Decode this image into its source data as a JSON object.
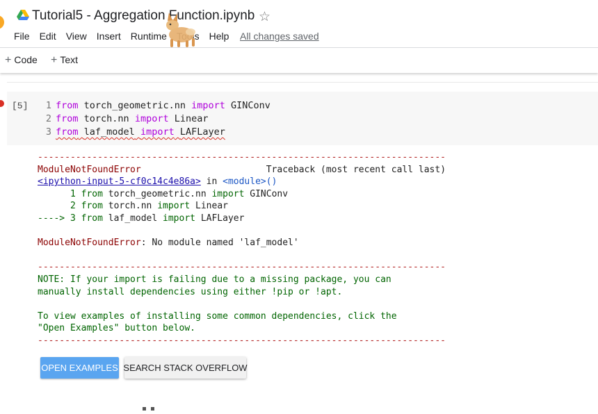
{
  "header": {
    "title": "Tutorial5 - Aggregation Function.ipynb",
    "star_icon": "star-outline-icon",
    "menu": [
      "File",
      "Edit",
      "View",
      "Insert",
      "Runtime",
      "Tools",
      "Help"
    ],
    "save_status": "All changes saved"
  },
  "toolbar": {
    "add_code": "Code",
    "add_text": "Text",
    "plus_glyph": "+"
  },
  "cell": {
    "exec_count": "[5]",
    "lines": [
      {
        "n": "1",
        "kw1": "from",
        "mod": "torch_geometric.nn",
        "kw2": "import",
        "name": "GINConv"
      },
      {
        "n": "2",
        "kw1": "from",
        "mod": "torch.nn",
        "kw2": "import",
        "name": "Linear"
      },
      {
        "n": "3",
        "kw1": "from",
        "mod": "laf_model",
        "kw2": "import",
        "name": "LAFLayer"
      }
    ]
  },
  "output": {
    "dashes": "---------------------------------------------------------------------------",
    "error_type": "ModuleNotFoundError",
    "traceback_label": "Traceback (most recent call last)",
    "input_link": "<ipython-input-5-cf0c14c4e86a>",
    "in_word": " in ",
    "module_word": "<module>()",
    "tb_lines": [
      {
        "prefix": "      1 ",
        "text_kw1": "from",
        "text_mod": " torch_geometric.nn ",
        "text_kw2": "import",
        "text_name": " GINConv"
      },
      {
        "prefix": "      2 ",
        "text_kw1": "from",
        "text_mod": " torch.nn ",
        "text_kw2": "import",
        "text_name": " Linear"
      },
      {
        "prefix": "----> 3 ",
        "text_kw1": "from",
        "text_mod": " laf_model ",
        "text_kw2": "import",
        "text_name": " LAFLayer"
      }
    ],
    "error_message": ": No module named 'laf_model'",
    "note_line1": "NOTE: If your import is failing due to a missing package, you can",
    "note_line2": "manually install dependencies using either !pip or !apt.",
    "note_line3": "To view examples of installing some common dependencies, click the",
    "note_line4": "\"Open Examples\" button below."
  },
  "buttons": {
    "open_examples": "OPEN EXAMPLES",
    "search_stack_overflow": "SEARCH STACK OVERFLOW"
  },
  "colors": {
    "keyword": "#af00db",
    "error_red": "#b22222",
    "note_green": "#006400",
    "primary_button": "#5aa5f0"
  }
}
